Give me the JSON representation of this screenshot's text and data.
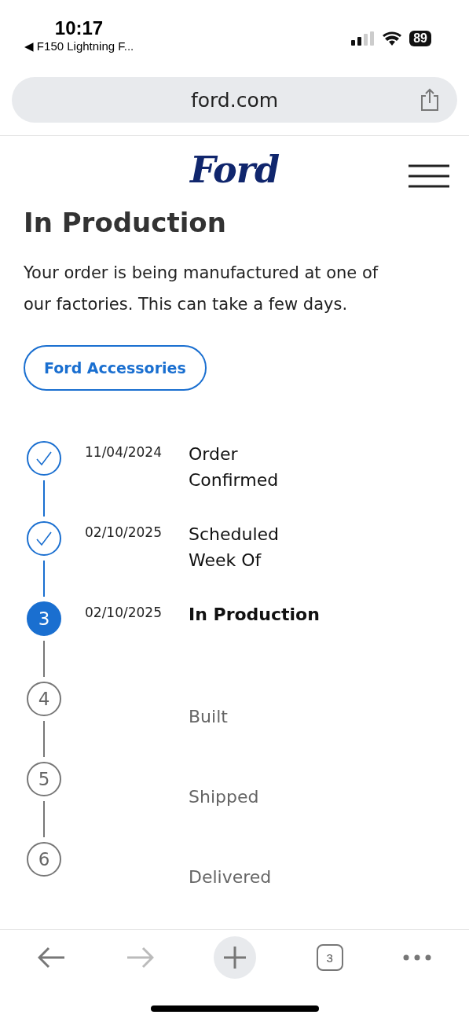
{
  "status_bar": {
    "time": "10:17",
    "back_app": "◀ F150 Lightning F...",
    "battery": "89"
  },
  "address_bar": {
    "url": "ford.com"
  },
  "header": {
    "logo": "Ford"
  },
  "page": {
    "title": "In Production",
    "description": "Your order is being manufactured at one of our factories. This can take a few days.",
    "button": "Ford Accessories"
  },
  "steps": [
    {
      "done": true,
      "current": false,
      "date": "11/04/2024",
      "label": "Order Confirmed"
    },
    {
      "done": true,
      "current": false,
      "date": "02/10/2025",
      "label": "Scheduled Week Of"
    },
    {
      "done": false,
      "current": true,
      "marker": "3",
      "date": "02/10/2025",
      "label": "In Production"
    },
    {
      "done": false,
      "current": false,
      "marker": "4",
      "label": "Built"
    },
    {
      "done": false,
      "current": false,
      "marker": "5",
      "label": "Shipped"
    },
    {
      "done": false,
      "current": false,
      "marker": "6",
      "label": "Delivered"
    }
  ],
  "toolbar": {
    "tab_count": "3"
  }
}
